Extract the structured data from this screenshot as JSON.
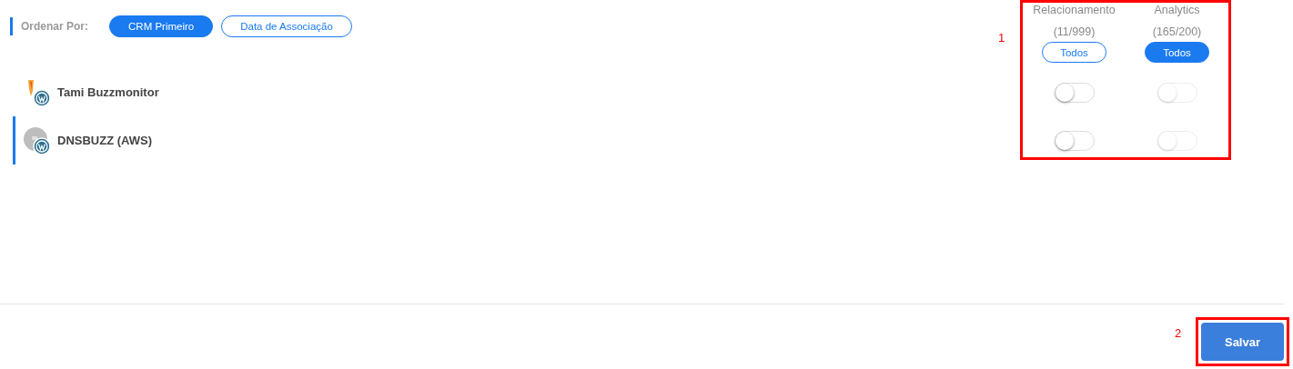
{
  "sort": {
    "label": "Ordenar Por:",
    "options": [
      {
        "label": "CRM Primeiro",
        "selected": true
      },
      {
        "label": "Data de Associação",
        "selected": false
      }
    ]
  },
  "columns": [
    {
      "title": "Relacionamento",
      "count": "(11/999)",
      "all_button": {
        "label": "Todos",
        "selected": false
      }
    },
    {
      "title": "Analytics",
      "count": "(165/200)",
      "all_button": {
        "label": "Todos",
        "selected": true
      }
    }
  ],
  "accounts": [
    {
      "name": "Tami Buzzmonitor",
      "kind": "flame",
      "selected": false,
      "toggles": [
        {
          "on": false,
          "disabled": false
        },
        {
          "on": false,
          "disabled": true
        }
      ]
    },
    {
      "name": "DNSBUZZ (AWS)",
      "kind": "gray",
      "selected": true,
      "toggles": [
        {
          "on": false,
          "disabled": false
        },
        {
          "on": false,
          "disabled": true
        }
      ]
    }
  ],
  "save_button": "Salvar",
  "annotations": [
    {
      "label": "1"
    },
    {
      "label": "2"
    }
  ]
}
